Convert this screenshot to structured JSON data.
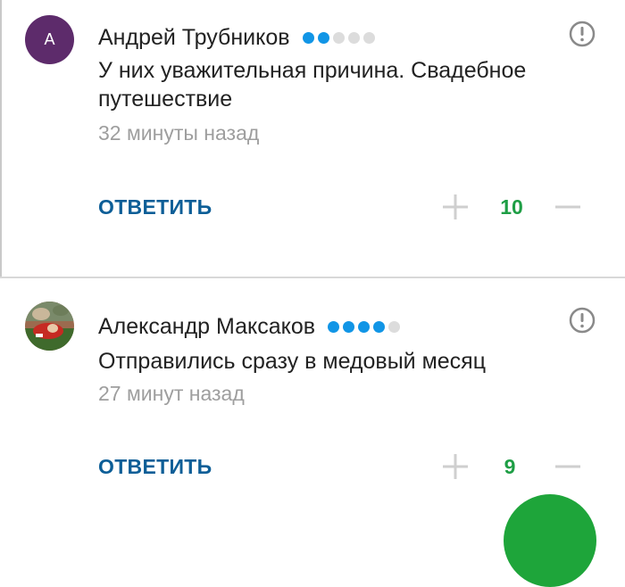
{
  "comments": [
    {
      "avatar_letter": "А",
      "author": "Андрей Трубников",
      "rating": {
        "filled": 2,
        "total": 5
      },
      "text": "У них уважительная причина.  Свадебное путешествие",
      "time": "32 минуты назад",
      "reply_label": "ОТВЕТИТЬ",
      "votes": "10"
    },
    {
      "avatar_image": "user-photo",
      "author": "Александр Максаков",
      "rating": {
        "filled": 4,
        "total": 5
      },
      "text": "Отправились сразу в медовый месяц",
      "time": "27 минут назад",
      "reply_label": "ОТВЕТИТЬ",
      "votes": "9"
    }
  ],
  "colors": {
    "accent": "#0d5e97",
    "vote_positive": "#1e9e45",
    "dot_filled": "#1195e6",
    "dot_empty": "#dcdcdc",
    "fab": "#1ea53a"
  },
  "icons": {
    "report": "exclamation-circle-icon",
    "upvote": "plus-icon",
    "downvote": "minus-icon"
  }
}
